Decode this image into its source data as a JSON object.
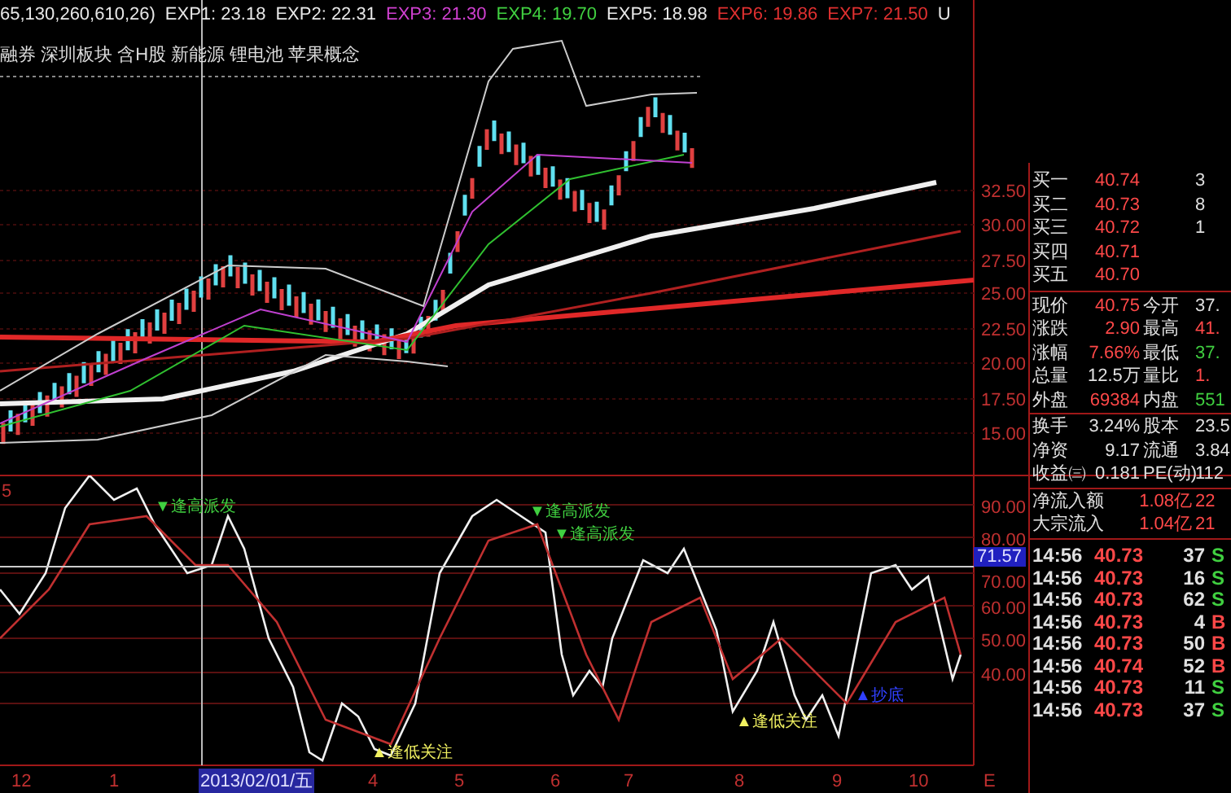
{
  "header": {
    "parameters": "65,130,260,610,26)",
    "indicators": [
      {
        "label": "EXP1: 23.18",
        "color": "#e8e8e8"
      },
      {
        "label": "EXP2: 22.31",
        "color": "#e8e8e8"
      },
      {
        "label": "EXP3: 21.30",
        "color": "#d040d0"
      },
      {
        "label": "EXP4: 19.70",
        "color": "#40d040"
      },
      {
        "label": "EXP5: 18.98",
        "color": "#e8e8e8"
      },
      {
        "label": "EXP6: 19.86",
        "color": "#e03030"
      },
      {
        "label": "EXP7: 21.50",
        "color": "#e03030"
      },
      {
        "label": "U",
        "color": "#e8e8e8"
      }
    ]
  },
  "concepts": "融券 深圳板块 含H股 新能源 锂电池 苹果概念",
  "price_axis": [
    "32.50",
    "30.00",
    "27.50",
    "25.00",
    "22.50",
    "20.00",
    "17.50",
    "15.00"
  ],
  "order_book": [
    {
      "label": "买一",
      "price": "40.74",
      "volume": "3"
    },
    {
      "label": "买二",
      "price": "40.73",
      "volume": "8"
    },
    {
      "label": "买三",
      "price": "40.72",
      "volume": "1"
    },
    {
      "label": "买四",
      "price": "40.71"
    },
    {
      "label": "买五",
      "price": "40.70"
    }
  ],
  "stats": [
    [
      [
        {
          "label": "现价",
          "value": "40.75",
          "color": "#ff4848"
        },
        {
          "label": "今开",
          "value": "37.",
          "color": "#e0e0e0"
        }
      ],
      [
        {
          "label": "涨跌",
          "value": "2.90",
          "color": "#ff4848"
        },
        {
          "label": "最高",
          "value": "41.",
          "color": "#ff4848"
        }
      ],
      [
        {
          "label": "涨幅",
          "value": "7.66%",
          "color": "#ff4848"
        },
        {
          "label": "最低",
          "value": "37.",
          "color": "#40d040"
        }
      ],
      [
        {
          "label": "总量",
          "value": "12.5万",
          "color": "#e0e0e0"
        },
        {
          "label": "量比",
          "value": "1.",
          "color": "#ff4848"
        }
      ],
      [
        {
          "label": "外盘",
          "value": "69384",
          "color": "#ff4848"
        },
        {
          "label": "内盘",
          "value": "551",
          "color": "#40d040"
        }
      ]
    ],
    [
      [
        {
          "label": "换手",
          "value": "3.24%",
          "color": "#e0e0e0"
        },
        {
          "label": "股本",
          "value": "23.5",
          "color": "#e0e0e0"
        }
      ],
      [
        {
          "label": "净资",
          "value": "9.17",
          "color": "#e0e0e0"
        },
        {
          "label": "流通",
          "value": "3.84",
          "color": "#e0e0e0"
        }
      ],
      [
        {
          "label": "收益㈢",
          "value": "0.181",
          "color": "#e0e0e0"
        },
        {
          "label": "PE(动)",
          "value": "112",
          "color": "#e0e0e0"
        }
      ]
    ],
    [
      [
        {
          "label": "净流入额",
          "value": "1.08亿",
          "color": "#ff4848"
        },
        {
          "value": "22",
          "color": "#ff4848"
        }
      ],
      [
        {
          "label": "大宗流入",
          "value": "1.04亿",
          "color": "#ff4848"
        },
        {
          "value": "21",
          "color": "#ff4848"
        }
      ]
    ]
  ],
  "trades": [
    {
      "time": "14:56",
      "price": "40.73",
      "volume": "37",
      "side": "S"
    },
    {
      "time": "14:56",
      "price": "40.73",
      "volume": "16",
      "side": "S"
    },
    {
      "time": "14:56",
      "price": "40.73",
      "volume": "62",
      "side": "S"
    },
    {
      "time": "14:56",
      "price": "40.73",
      "volume": "4",
      "side": "B"
    },
    {
      "time": "14:56",
      "price": "40.73",
      "volume": "50",
      "side": "B"
    },
    {
      "time": "14:56",
      "price": "40.74",
      "volume": "52",
      "side": "B"
    },
    {
      "time": "14:56",
      "price": "40.73",
      "volume": "11",
      "side": "S"
    },
    {
      "time": "14:56",
      "price": "40.73",
      "volume": "37",
      "side": "S"
    }
  ],
  "oscillator": {
    "label": "5",
    "axis": [
      "90.00",
      "80.00",
      "70.00",
      "60.00",
      "50.00",
      "40.00"
    ],
    "current": "71.57",
    "signals": [
      {
        "kind": "sell",
        "text": "▼逢高派发"
      },
      {
        "kind": "sell",
        "text": "▼逢高派发"
      },
      {
        "kind": "sell",
        "text": "▼逢高派发"
      },
      {
        "kind": "watch",
        "text": "▲逢低关注"
      },
      {
        "kind": "watch",
        "text": "▲逢低关注"
      },
      {
        "kind": "buy",
        "text": "▲抄底"
      }
    ]
  },
  "x_axis": [
    {
      "label": "12",
      "selected": false
    },
    {
      "label": "1",
      "selected": false
    },
    {
      "label": "2013/02/01/五",
      "selected": true
    },
    {
      "label": "4",
      "selected": false
    },
    {
      "label": "5",
      "selected": false
    },
    {
      "label": "6",
      "selected": false
    },
    {
      "label": "7",
      "selected": false
    },
    {
      "label": "8",
      "selected": false
    },
    {
      "label": "9",
      "selected": false
    },
    {
      "label": "10",
      "selected": false
    },
    {
      "label": "E",
      "selected": false
    }
  ]
}
